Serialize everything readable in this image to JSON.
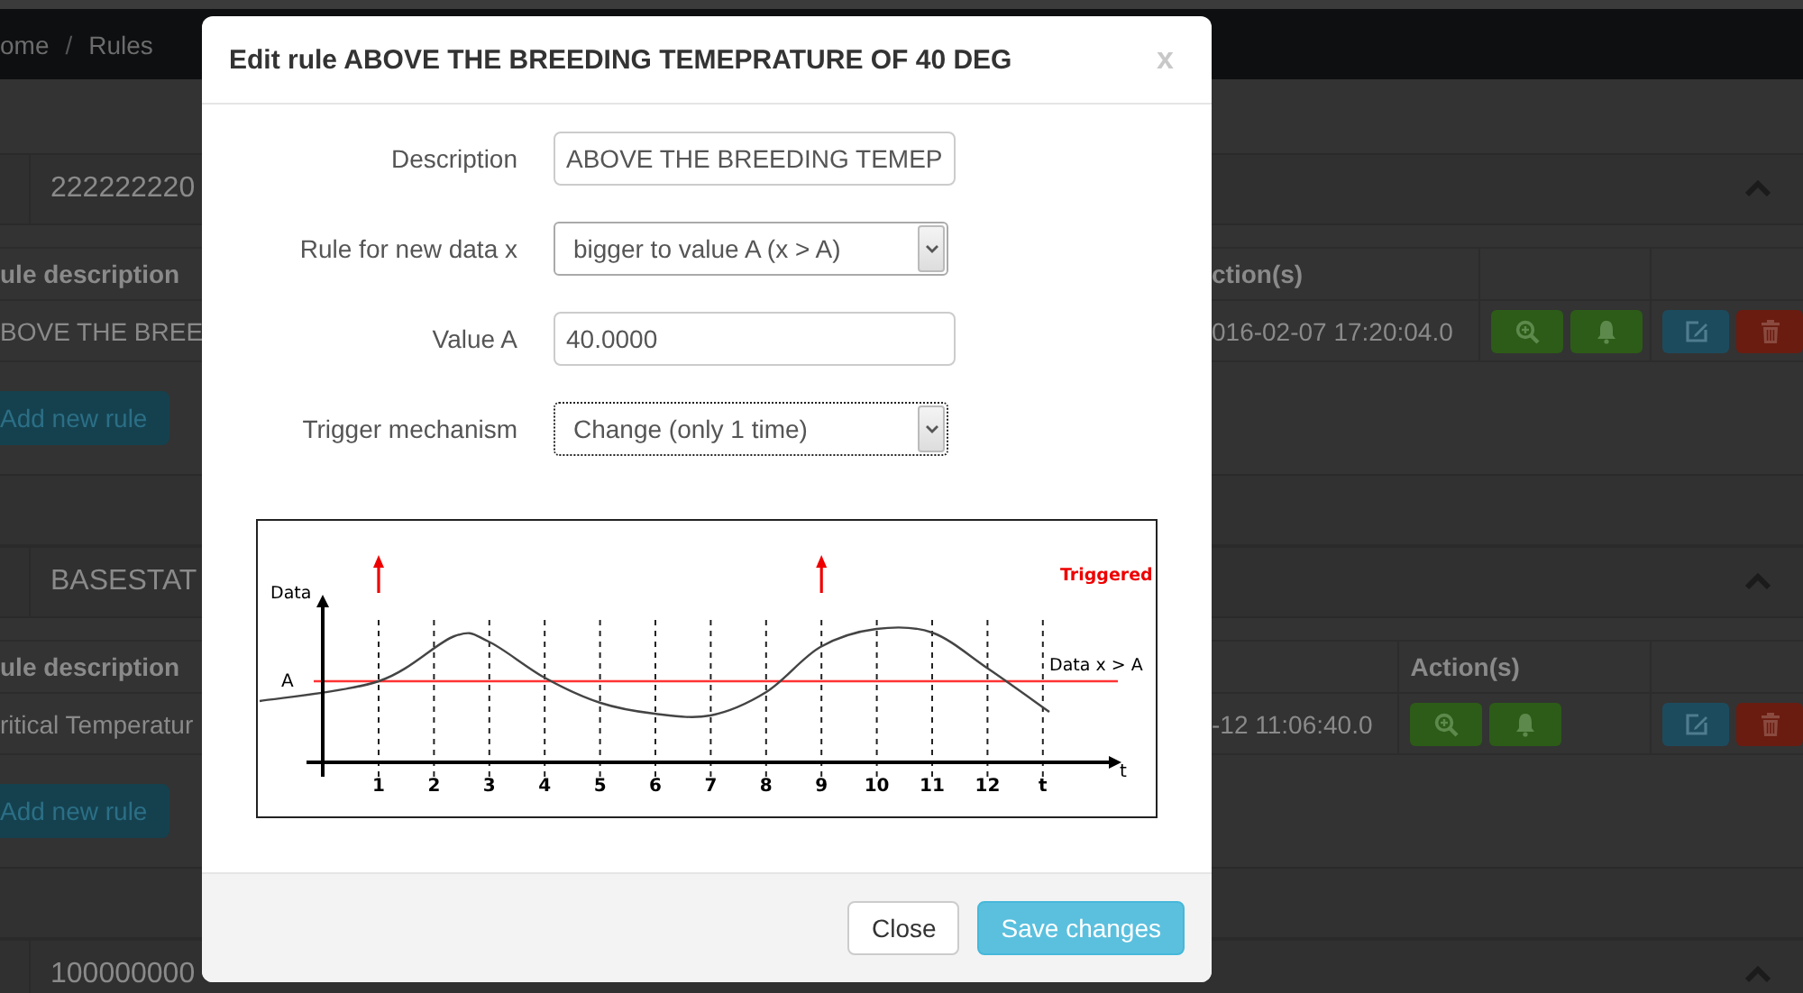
{
  "navbar": {
    "breadcrumb": [
      {
        "label": "ome",
        "kind": "link"
      },
      {
        "label": "/",
        "kind": "separator"
      },
      {
        "label": "Rules",
        "kind": "current"
      }
    ]
  },
  "panels": [
    {
      "title": "222222220",
      "columns": [
        {
          "label": "ule description",
          "kind": "description"
        },
        {
          "label": "ction(s)",
          "kind": "timestamp"
        }
      ],
      "rows": [
        {
          "description": "BOVE THE BREE",
          "timestamp": "016-02-07 17:20:04.0"
        }
      ],
      "add_button": "Add new rule"
    },
    {
      "title": "BASESTAT",
      "columns": [
        {
          "label": "ule description",
          "kind": "description"
        },
        {
          "label": "Action(s)",
          "kind": "actions"
        }
      ],
      "rows": [
        {
          "description": "ritical Temperatur",
          "timestamp": "-12 11:06:40.0"
        }
      ],
      "add_button": "Add new rule"
    },
    {
      "title": "100000000"
    }
  ],
  "modal": {
    "title": "Edit rule ABOVE THE BREEDING TEMEPRATURE OF 40 DEG",
    "close": "x",
    "fields": [
      {
        "kind": "text",
        "label": "Description",
        "value": "ABOVE THE BREEDING TEMEP",
        "focused": false
      },
      {
        "kind": "select",
        "label": "Rule for new data x",
        "value": "bigger to value A (x > A)",
        "focused": false
      },
      {
        "kind": "text",
        "label": "Value A",
        "value": "40.0000",
        "focused": false
      },
      {
        "kind": "select",
        "label": "Trigger mechanism",
        "value": "Change (only 1 time)",
        "focused": true
      }
    ],
    "diagram": {
      "y_label": "Data",
      "threshold_label": "A",
      "threshold_caption": "Data x > A",
      "trigger_caption": "Triggered",
      "x_axis_label": "t",
      "ticks": [
        {
          "label": "1",
          "triggered": true
        },
        {
          "label": "2",
          "triggered": false
        },
        {
          "label": "3",
          "triggered": false
        },
        {
          "label": "4",
          "triggered": false
        },
        {
          "label": "5",
          "triggered": false
        },
        {
          "label": "6",
          "triggered": false
        },
        {
          "label": "7",
          "triggered": false
        },
        {
          "label": "8",
          "triggered": false
        },
        {
          "label": "9",
          "triggered": true
        },
        {
          "label": "10",
          "triggered": false
        },
        {
          "label": "11",
          "triggered": false
        },
        {
          "label": "12",
          "triggered": false
        },
        {
          "label": "t",
          "triggered": false
        }
      ]
    },
    "buttons": [
      {
        "label": "Close",
        "kind": "default"
      },
      {
        "label": "Save changes",
        "kind": "primary"
      }
    ]
  }
}
